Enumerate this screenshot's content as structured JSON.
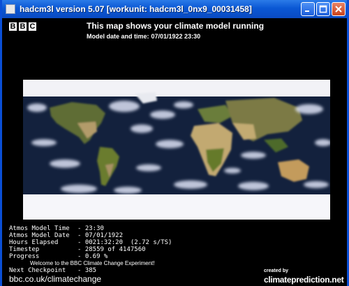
{
  "window": {
    "title": "hadcm3l version 5.07 [workunit: hadcm3l_0nx9_00031458]",
    "controls": [
      "minimize-icon",
      "maximize-icon",
      "close-icon"
    ]
  },
  "header": {
    "logo": [
      "B",
      "B",
      "C"
    ],
    "title": "This map shows your climate model running",
    "model_date_label": "Model date and time:",
    "model_date_value": "07/01/1922 23:30"
  },
  "stats": [
    {
      "label": "Atmos Model Time",
      "value": "- 23:30"
    },
    {
      "label": "Atmos Model Date",
      "value": "- 07/01/1922"
    },
    {
      "label": "Hours Elapsed",
      "value": "- 0021:32:20  (2.72 s/TS)"
    },
    {
      "label": "Timestep",
      "value": "- 28559 of 4147560"
    },
    {
      "label": "Progress",
      "value": "- 0.69 %"
    }
  ],
  "progress_fraction": 0.0069,
  "welcome": "Welcome to the BBC Climate Change Experiment!",
  "checkpoint": {
    "label": "Next Checkpoint",
    "value": "- 385"
  },
  "footer": {
    "bbc_url": "bbc.co.uk/climatechange",
    "created_by": "created by",
    "cp_url": "climateprediction.net"
  },
  "colors": {
    "titlebar": "#0a57d4",
    "ocean": "#0b1a2f",
    "cloud": "#dde2f5",
    "land": "#6f8a3a",
    "desert": "#b49a62"
  }
}
